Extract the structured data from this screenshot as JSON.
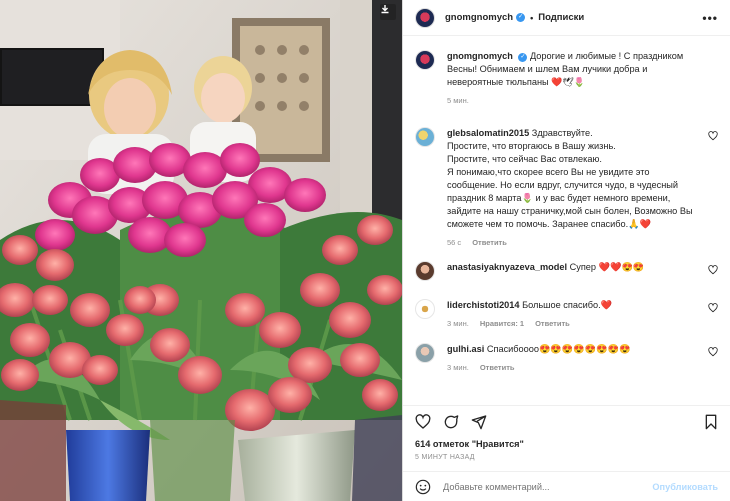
{
  "post": {
    "author": "gnomgnomych",
    "follow_label": "Подписки",
    "more_label": "•••",
    "caption": {
      "text": "Дорогие и любимые ! С праздником Весны! Обнимаем и шлем Вам лучики добра и невероятные тюльпаны",
      "emoji": "❤️🕊🌷",
      "time": "5 мин."
    }
  },
  "comments": [
    {
      "user": "glebsalomatin2015",
      "text": "Здравствуйте.\nПростите, что вторгаюсь в Вашу жизнь.\nПростите, что сейчас Вас отвлекаю.\nЯ понимаю,что скорее всего Вы не увидите это сообщение. Но если вдруг, случится чудо, в чудесный праздник 8 марта🌷 и у вас будет немного времени, зайдите на нашу страничку,мой сын болен, Возможно Вы сможете чем то помочь. Заранее спасибо.🙏❤️",
      "time": "56 с",
      "reply_label": "Ответить",
      "likes_label": ""
    },
    {
      "user": "anastasiyaknyazeva_model",
      "text": "Супер ❤️❤️😍😍",
      "time": "",
      "reply_label": "",
      "likes_label": ""
    },
    {
      "user": "liderchistoti2014",
      "text": "Большое спасибо.❤️",
      "time": "3 мин.",
      "reply_label": "Ответить",
      "likes_label": "Нравится: 1"
    },
    {
      "user": "gulhi.asi",
      "text": "Спасибоооо😍😍😍😍😍😍😍😍",
      "time": "3 мин.",
      "reply_label": "Ответить",
      "likes_label": ""
    }
  ],
  "footer": {
    "likes": "614 отметок \"Нравится\"",
    "date": "5 МИНУТ НАЗАД",
    "comment_placeholder": "Добавьте комментарий...",
    "publish_label": "Опубликовать"
  },
  "icons": [
    "heart-icon",
    "comment-icon",
    "share-icon",
    "bookmark-icon",
    "emoji-icon",
    "download-icon",
    "verified-icon"
  ],
  "colors": {
    "verified": "#3897f0",
    "publish": "#b3dbff",
    "muted": "#8e8e8e",
    "heart_red": "#ed4956"
  }
}
